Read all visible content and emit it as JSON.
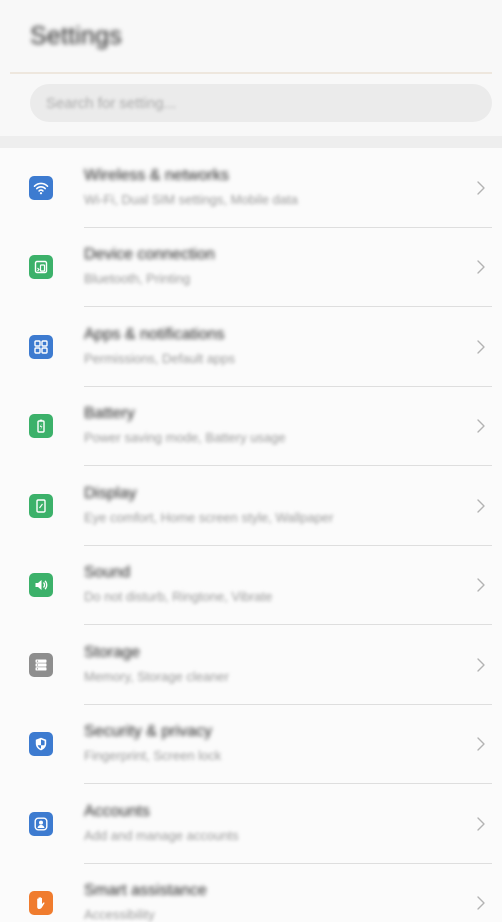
{
  "header": {
    "title": "Settings"
  },
  "search": {
    "placeholder": "Search for setting..."
  },
  "items": [
    {
      "key": "wireless",
      "title": "Wireless & networks",
      "subtitle": "Wi-Fi, Dual SIM settings, Mobile data",
      "color": "#3d7bd0",
      "icon": "wifi-icon"
    },
    {
      "key": "device-connection",
      "title": "Device connection",
      "subtitle": "Bluetooth, Printing",
      "color": "#3cb16a",
      "icon": "device-connection-icon"
    },
    {
      "key": "apps",
      "title": "Apps & notifications",
      "subtitle": "Permissions, Default apps",
      "color": "#3d7bd0",
      "icon": "apps-grid-icon"
    },
    {
      "key": "battery",
      "title": "Battery",
      "subtitle": "Power saving mode, Battery usage",
      "color": "#3cb16a",
      "icon": "battery-icon"
    },
    {
      "key": "display",
      "title": "Display",
      "subtitle": "Eye comfort, Home screen style, Wallpaper",
      "color": "#3cb16a",
      "icon": "display-icon"
    },
    {
      "key": "sound",
      "title": "Sound",
      "subtitle": "Do not disturb, Ringtone, Vibrate",
      "color": "#3cb16a",
      "icon": "speaker-icon"
    },
    {
      "key": "storage",
      "title": "Storage",
      "subtitle": "Memory, Storage cleaner",
      "color": "#8e8e8e",
      "icon": "storage-icon"
    },
    {
      "key": "security",
      "title": "Security & privacy",
      "subtitle": "Fingerprint, Screen lock",
      "color": "#3d7bd0",
      "icon": "shield-icon"
    },
    {
      "key": "accounts",
      "title": "Accounts",
      "subtitle": "Add and manage accounts",
      "color": "#3d7bd0",
      "icon": "account-icon"
    },
    {
      "key": "smart-assistance",
      "title": "Smart assistance",
      "subtitle": "Accessibility",
      "color": "#f07c2e",
      "icon": "hand-icon"
    }
  ]
}
